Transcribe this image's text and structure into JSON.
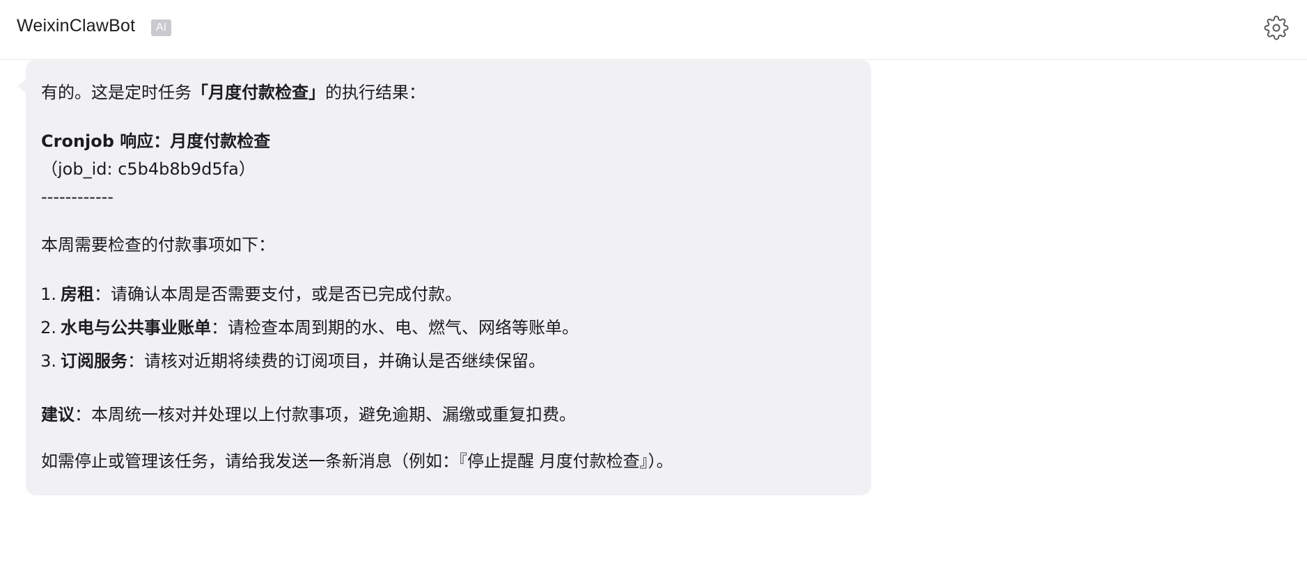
{
  "header": {
    "title": "WeixinClawBot",
    "badge": "AI",
    "settings_icon": "gear-icon"
  },
  "message": {
    "intro_pre": "有的。这是定时任务",
    "intro_task": "「月度付款检查」",
    "intro_post": "的执行结果：",
    "cron_line1": "Cronjob 响应：月度付款检查",
    "cron_line2": "（job_id: c5b4b8b9d5fa）",
    "divider": "------------",
    "list_heading": "本周需要检查的付款事项如下：",
    "items": [
      {
        "num": "1.",
        "title": "房租",
        "sep": "：",
        "text": "请确认本周是否需要支付，或是否已完成付款。"
      },
      {
        "num": "2.",
        "title": "水电与公共事业账单",
        "sep": "：",
        "text": "请检查本周到期的水、电、燃气、网络等账单。"
      },
      {
        "num": "3.",
        "title": "订阅服务",
        "sep": "：",
        "text": "请核对近期将续费的订阅项目，并确认是否继续保留。"
      }
    ],
    "advice_label": "建议",
    "advice_sep": "：",
    "advice_text": "本周统一核对并处理以上付款事项，避免逾期、漏缴或重复扣费。",
    "footer": "如需停止或管理该任务，请给我发送一条新消息（例如：『停止提醒 月度付款检查』）。"
  },
  "colors": {
    "bubble_bg": "#f1f1f4",
    "badge_bg": "#c9c9ce",
    "text": "#1c1c1e"
  }
}
